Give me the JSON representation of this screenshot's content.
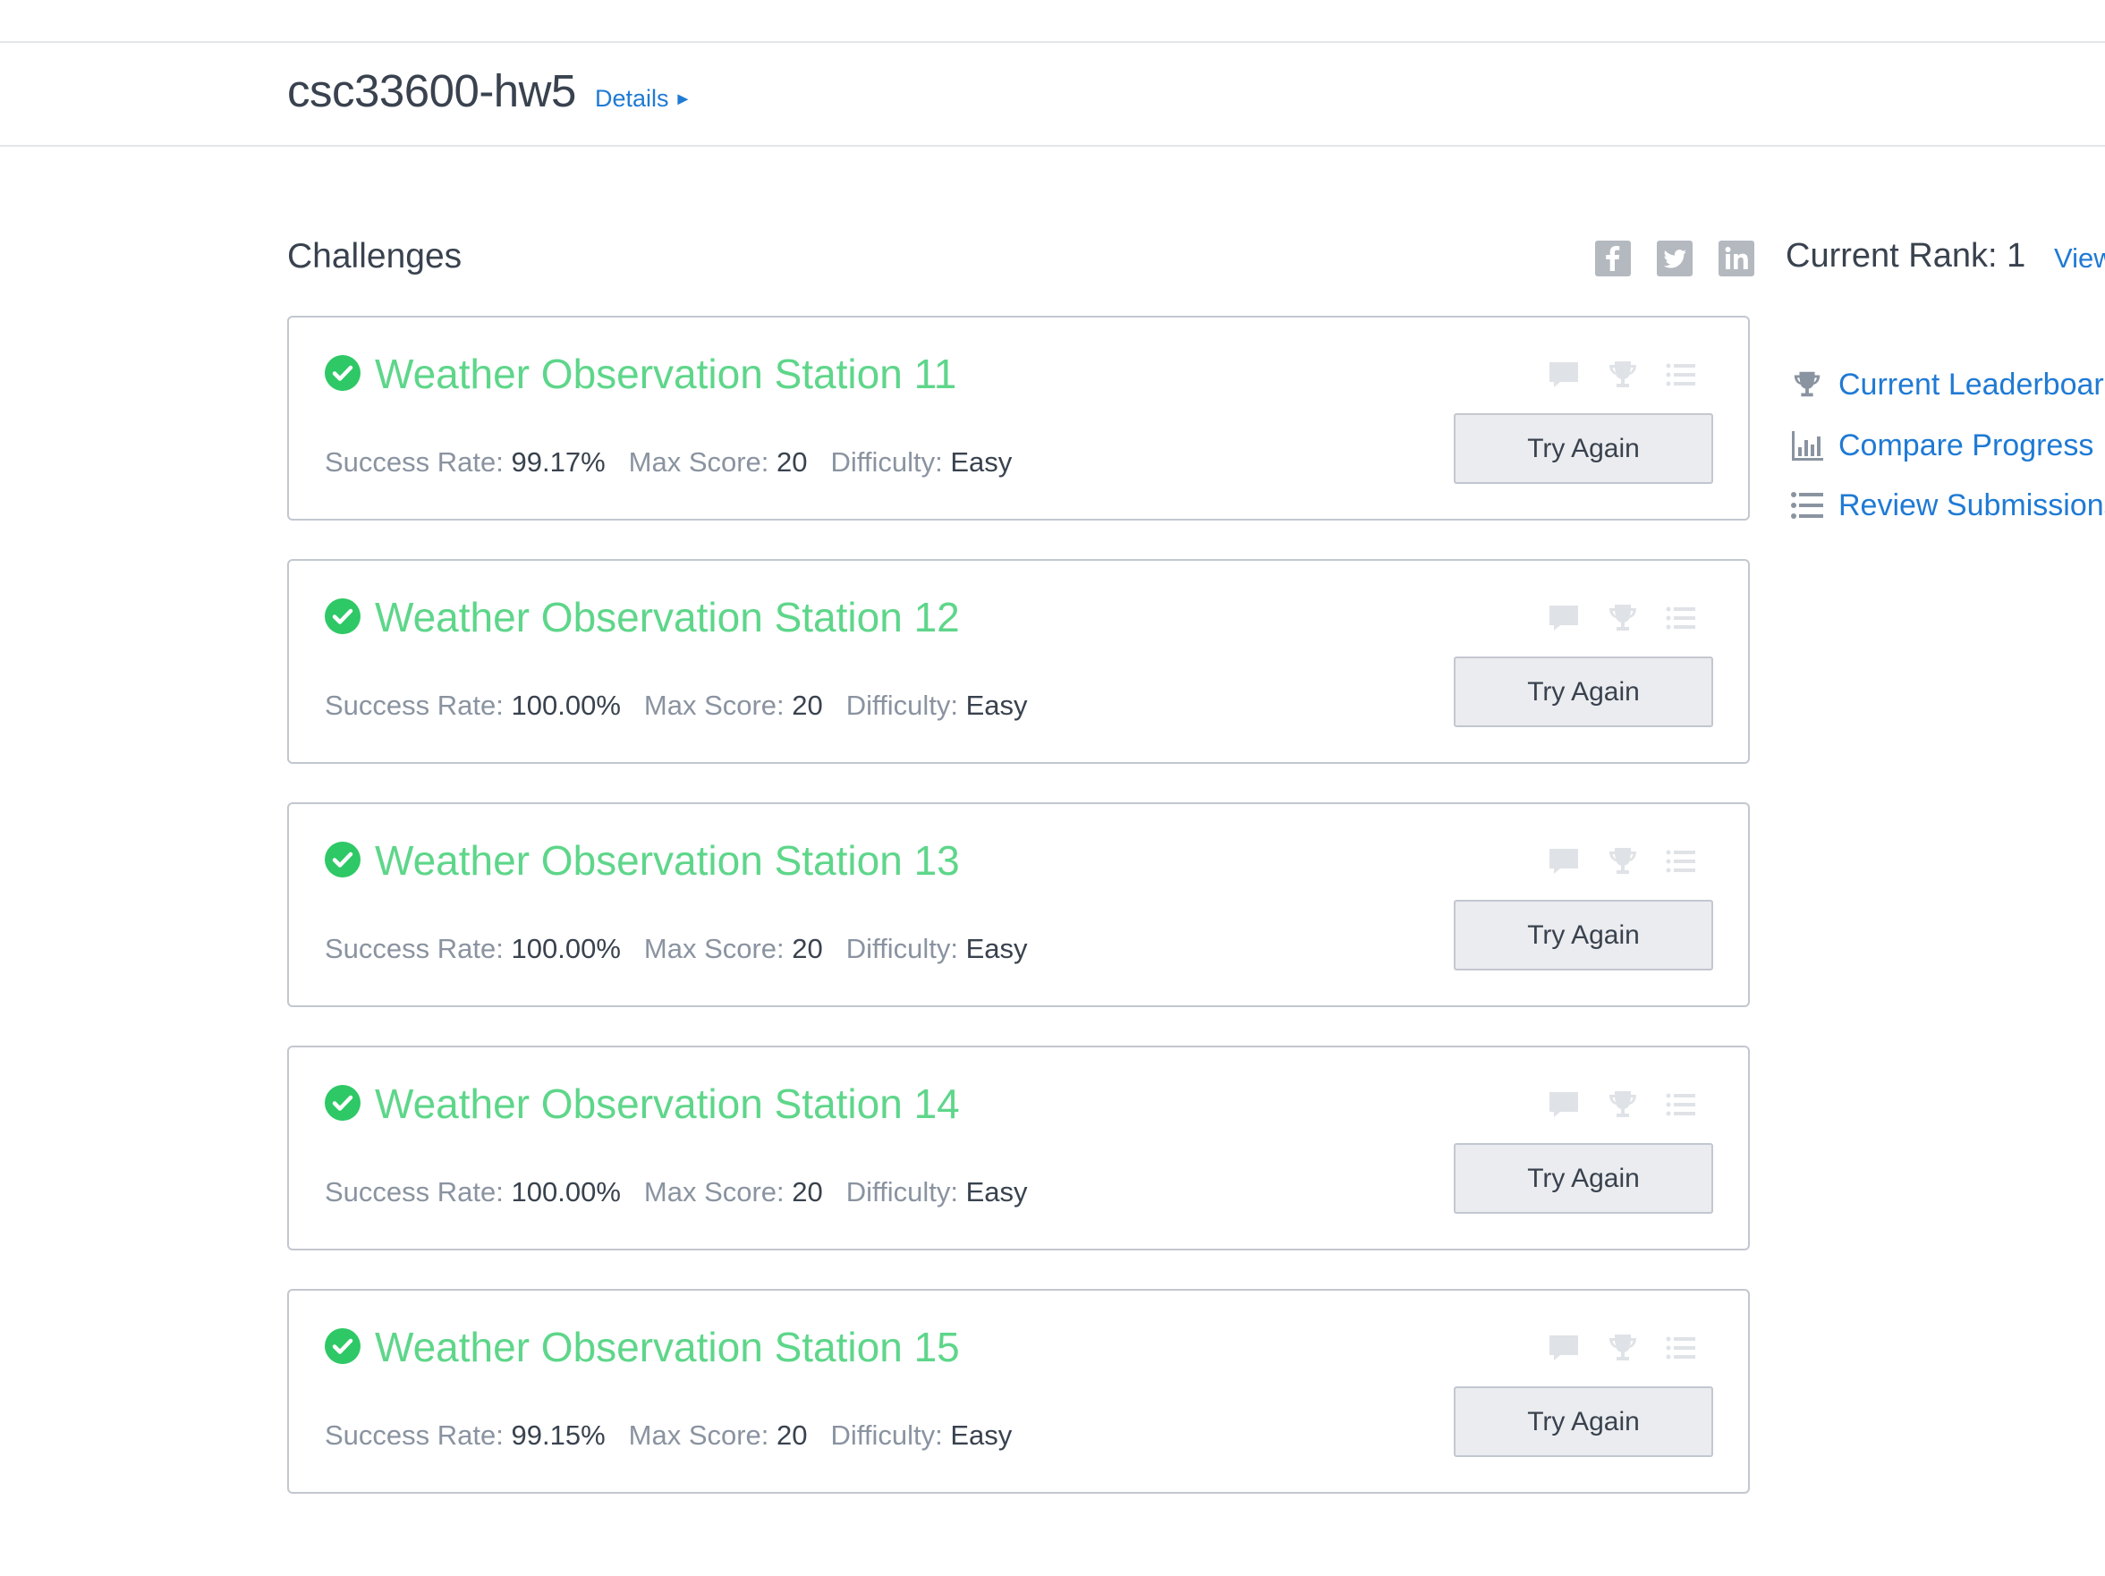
{
  "header": {
    "title": "csc33600-hw5",
    "details_label": "Details",
    "details_arrow": "►"
  },
  "main": {
    "section_title": "Challenges"
  },
  "share_icons": [
    "facebook-icon",
    "twitter-icon",
    "linkedin-icon"
  ],
  "sidebar": {
    "rank_label": "Current Rank: 1",
    "view_label": "View",
    "links": [
      {
        "label": "Current Leaderboard",
        "icon": "trophy-icon"
      },
      {
        "label": "Compare Progress",
        "icon": "bar-chart-icon"
      },
      {
        "label": "Review Submissions",
        "icon": "list-icon"
      }
    ]
  },
  "challenges": [
    {
      "name": "Weather Observation Station 11",
      "success_label": "Success Rate:",
      "success_rate": "99.17%",
      "max_label": "Max Score:",
      "max_score": "20",
      "difficulty_label": "Difficulty:",
      "difficulty": "Easy",
      "button": "Try Again"
    },
    {
      "name": "Weather Observation Station 12",
      "success_label": "Success Rate:",
      "success_rate": "100.00%",
      "max_label": "Max Score:",
      "max_score": "20",
      "difficulty_label": "Difficulty:",
      "difficulty": "Easy",
      "button": "Try Again"
    },
    {
      "name": "Weather Observation Station 13",
      "success_label": "Success Rate:",
      "success_rate": "100.00%",
      "max_label": "Max Score:",
      "max_score": "20",
      "difficulty_label": "Difficulty:",
      "difficulty": "Easy",
      "button": "Try Again"
    },
    {
      "name": "Weather Observation Station 14",
      "success_label": "Success Rate:",
      "success_rate": "100.00%",
      "max_label": "Max Score:",
      "max_score": "20",
      "difficulty_label": "Difficulty:",
      "difficulty": "Easy",
      "button": "Try Again"
    },
    {
      "name": "Weather Observation Station 15",
      "success_label": "Success Rate:",
      "success_rate": "99.15%",
      "max_label": "Max Score:",
      "max_score": "20",
      "difficulty_label": "Difficulty:",
      "difficulty": "Easy",
      "button": "Try Again"
    }
  ],
  "colors": {
    "link": "#1f7ad4",
    "solved": "#5ed68a",
    "check": "#2ec866",
    "text": "#39424e",
    "muted": "#8a93a0",
    "icon_faded": "#dfe2e6"
  }
}
